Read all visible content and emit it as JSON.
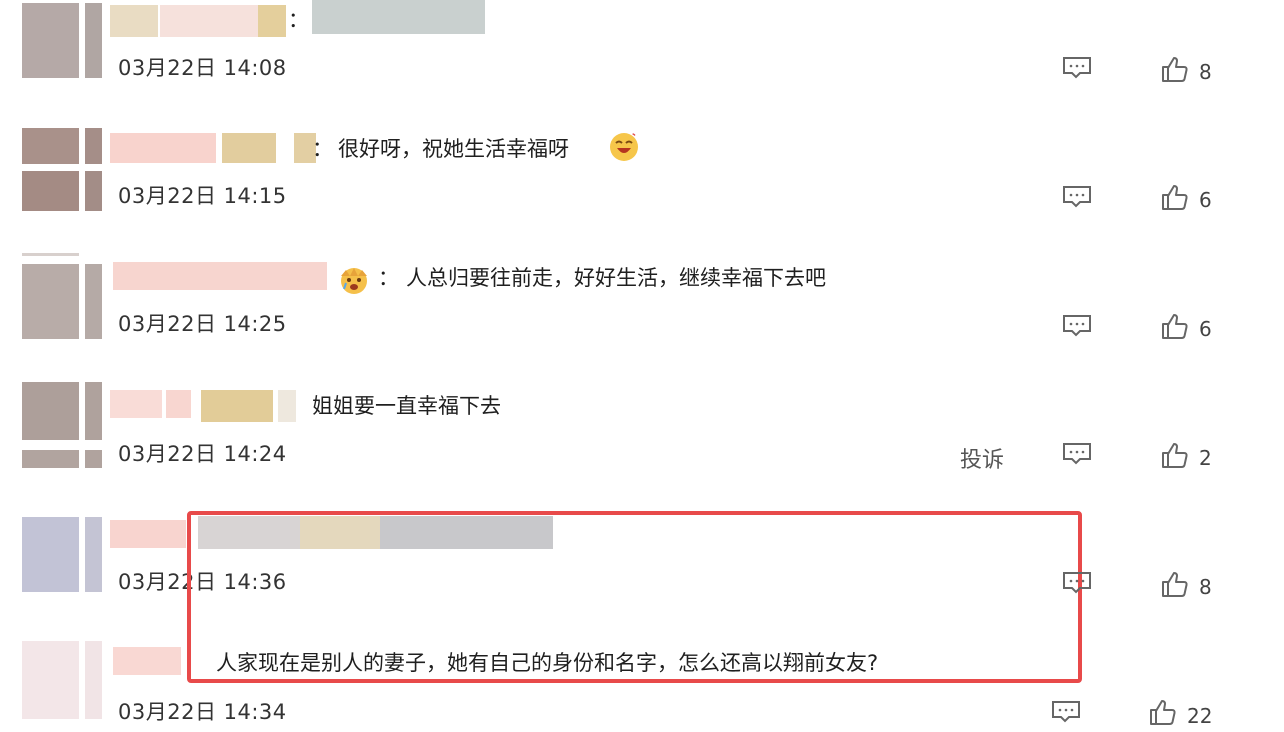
{
  "comments": [
    {
      "time": "03月22日 14:08",
      "text": "",
      "likes": "8"
    },
    {
      "time": "03月22日 14:15",
      "text": "很好呀，祝她生活幸福呀",
      "likes": "6",
      "emoji": "laughing-emoji"
    },
    {
      "time": "03月22日 14:25",
      "text": "人总归要往前走，好好生活，继续幸福下去吧",
      "likes": "6",
      "emoji": "crying-emoji"
    },
    {
      "time": "03月22日 14:24",
      "text": "姐姐要一直幸福下去",
      "likes": "2",
      "report": "投诉"
    },
    {
      "time": "03月22日 14:36",
      "text": "",
      "likes": "8"
    },
    {
      "time": "03月22日 14:34",
      "text": "人家现在是别人的妻子，她有自己的身份和名字，怎么还高以翔前女友?",
      "likes": "22"
    }
  ],
  "separator": "：",
  "colors": {
    "highlight": "#e84a4a",
    "blur_pink": "#f7d2cc",
    "blur_tan": "#e8d3a5",
    "blur_grey": "#c9cccc"
  }
}
